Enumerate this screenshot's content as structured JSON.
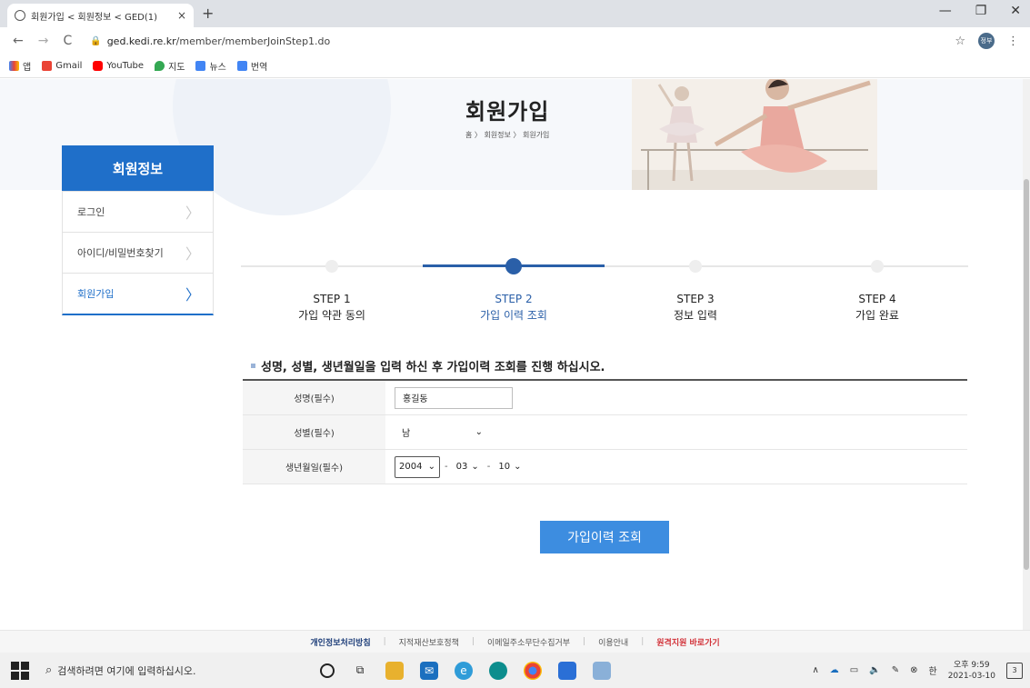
{
  "browser": {
    "tab_title": "회원가입 < 회원정보 < GED(1)",
    "tab_close": "×",
    "new_tab": "+",
    "url_host": "ged.kedi.re.kr",
    "url_path": "/member/memberJoinStep1.do",
    "avatar_text": "정부",
    "bookmarks": [
      "앱",
      "Gmail",
      "YouTube",
      "지도",
      "뉴스",
      "번역"
    ]
  },
  "hero": {
    "title": "회원가입",
    "breadcrumb": "홈 〉 회원정보 〉 회원가입"
  },
  "sidebar": {
    "heading": "회원정보",
    "items": [
      {
        "label": "로그인"
      },
      {
        "label": "아이디/비밀번호찾기"
      },
      {
        "label": "회원가입"
      }
    ]
  },
  "steps": [
    {
      "num": "STEP 1",
      "label": "가입 약관 동의"
    },
    {
      "num": "STEP 2",
      "label": "가입 이력 조회"
    },
    {
      "num": "STEP 3",
      "label": "정보 입력"
    },
    {
      "num": "STEP 4",
      "label": "가입 완료"
    }
  ],
  "current_step": 2,
  "form": {
    "instruction": "성명, 성별, 생년월일을 입력 하신 후 가입이력 조회를 진행 하십시오.",
    "name_label": "성명(필수)",
    "name_value": "홍길동",
    "gender_label": "성별(필수)",
    "gender_value": "남",
    "dob_label": "생년월일(필수)",
    "dob_year": "2004",
    "dob_month": "03",
    "dob_day": "10",
    "submit_label": "가입이력 조회"
  },
  "footer": {
    "links": [
      "개인정보처리방침",
      "지적재산보호정책",
      "이메일주소무단수집거부",
      "이용안내",
      "원격지원 바로가기"
    ]
  },
  "taskbar": {
    "search_placeholder": "검색하려면 여기에 입력하십시오.",
    "ime": "한",
    "time": "오후 9:59",
    "date": "2021-03-10",
    "notif_count": "3"
  },
  "colors": {
    "primary": "#1f6fc9",
    "step_active": "#2a5fa8",
    "button": "#3d8de0",
    "footer_red": "#d2333a"
  }
}
